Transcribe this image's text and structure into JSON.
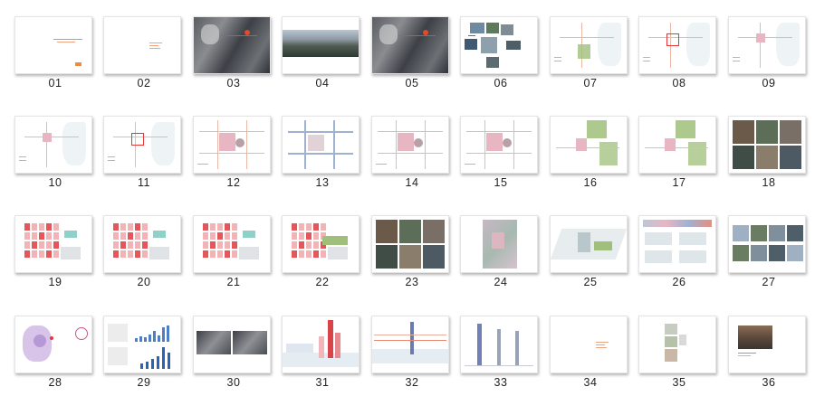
{
  "window": {
    "title": ""
  },
  "slides": [
    {
      "num": "01",
      "kind": "title"
    },
    {
      "num": "02",
      "kind": "blank-text"
    },
    {
      "num": "03",
      "kind": "dark-map"
    },
    {
      "num": "04",
      "kind": "panorama"
    },
    {
      "num": "05",
      "kind": "dark-map"
    },
    {
      "num": "06",
      "kind": "photo-collage"
    },
    {
      "num": "07",
      "kind": "site-map-green"
    },
    {
      "num": "08",
      "kind": "site-map-red"
    },
    {
      "num": "09",
      "kind": "site-map-light"
    },
    {
      "num": "10",
      "kind": "site-map-light"
    },
    {
      "num": "11",
      "kind": "site-map-red"
    },
    {
      "num": "12",
      "kind": "block-plan-pink"
    },
    {
      "num": "13",
      "kind": "block-plan-blue"
    },
    {
      "num": "14",
      "kind": "block-plan-pink"
    },
    {
      "num": "15",
      "kind": "block-plan-pink"
    },
    {
      "num": "16",
      "kind": "site-plan-green"
    },
    {
      "num": "17",
      "kind": "site-plan-green"
    },
    {
      "num": "18",
      "kind": "photo-grid"
    },
    {
      "num": "19",
      "kind": "master-plan-red"
    },
    {
      "num": "20",
      "kind": "master-plan-red"
    },
    {
      "num": "21",
      "kind": "master-plan-red"
    },
    {
      "num": "22",
      "kind": "master-plan-green"
    },
    {
      "num": "23",
      "kind": "photo-grid"
    },
    {
      "num": "24",
      "kind": "aerial-plan"
    },
    {
      "num": "25",
      "kind": "axonometric"
    },
    {
      "num": "26",
      "kind": "axonometric-strip"
    },
    {
      "num": "27",
      "kind": "photo-grid-small"
    },
    {
      "num": "28",
      "kind": "diagram-purple"
    },
    {
      "num": "29",
      "kind": "bar-chart"
    },
    {
      "num": "30",
      "kind": "dark-pair"
    },
    {
      "num": "31",
      "kind": "skyline-red"
    },
    {
      "num": "32",
      "kind": "skyline-line"
    },
    {
      "num": "33",
      "kind": "towers"
    },
    {
      "num": "34",
      "kind": "blank-text"
    },
    {
      "num": "35",
      "kind": "plan-blocks"
    },
    {
      "num": "36",
      "kind": "street-photo"
    }
  ],
  "colors": {
    "accent": "#e15b30",
    "caption": "#222222",
    "pink": "#e8b5c3",
    "green": "#9fbf7a",
    "blue": "#9fb1d3"
  }
}
